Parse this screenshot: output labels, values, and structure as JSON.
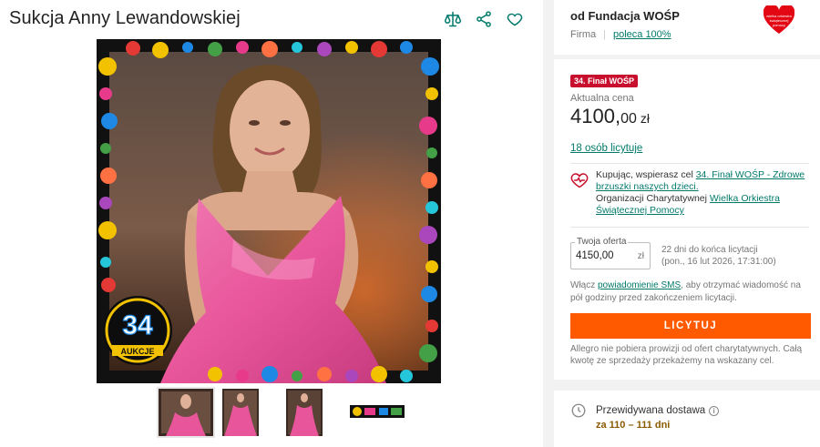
{
  "product": {
    "title": "Sukcja Anny Lewandowskiej"
  },
  "actions": {
    "compare_icon": "scale-icon",
    "share_icon": "share-icon",
    "favorite_icon": "heart-outline-icon"
  },
  "gallery": {
    "thumbnail_count": 4,
    "badge_number": "34",
    "badge_text": "AUKCJE"
  },
  "seller": {
    "name": "od Fundacja WOŚP",
    "type": "Firma",
    "recommend": "poleca 100%",
    "logo_text": "wielka orkiestra świątecznej pomocy"
  },
  "offer": {
    "badge": "34. Finał WOŚP",
    "price_label": "Aktualna cena",
    "price_main": "4100,",
    "price_cents": "00",
    "currency": "zł",
    "bidders": "18 osób licytuje"
  },
  "support": {
    "text_1": "Kupując, wspierasz cel ",
    "goal_link": "34. Finał WOŚP - Zdrowe brzuszki naszych dzieci.",
    "text_2": "Organizacji Charytatywnej ",
    "org_link": "Wielka Orkiestra Świątecznej Pomocy"
  },
  "bid": {
    "legend": "Twoja oferta",
    "value": "4150,00",
    "unit": "zł",
    "time_left_1": "22 dni do końca licytacji",
    "time_left_2": "(pon., 16 lut 2026, 17:31:00)",
    "sms_1": "Włącz ",
    "sms_link": "powiadomienie SMS",
    "sms_2": ", aby otrzymać wiadomość na pół godziny przed zakończeniem licytacji.",
    "button": "LICYTUJ",
    "fee_note": "Allegro nie pobiera prowizji od ofert charytatywnych. Całą kwotę ze sprzedaży przekażemy na wskazany cel."
  },
  "delivery": {
    "label": "Przewidywana dostawa",
    "value": "za 110 – 111 dni"
  },
  "colors": {
    "accent": "#00796b",
    "cta": "#ff5a00",
    "badge": "#c8102e",
    "dress": "#e8559a"
  }
}
